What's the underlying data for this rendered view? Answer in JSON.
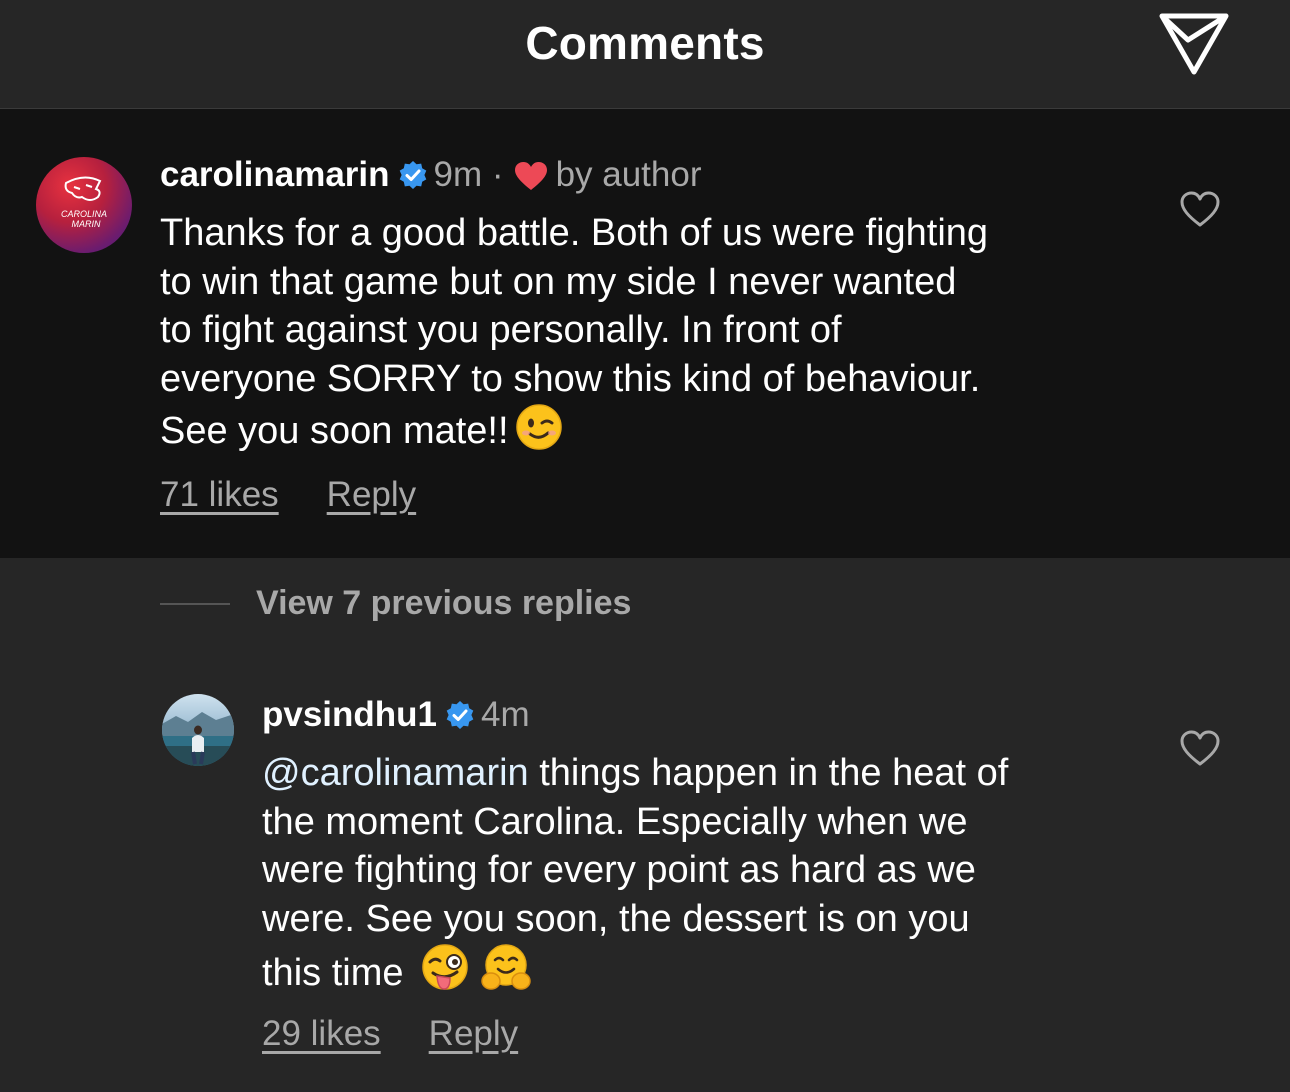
{
  "header": {
    "title": "Comments",
    "send_icon": "paper-plane-icon"
  },
  "comment": {
    "username": "carolinamarin",
    "verified": true,
    "time": "9m",
    "separator": "·",
    "liked_by_author_label": "by author",
    "avatar_text": [
      "CAROLINA",
      "MARIN"
    ],
    "text_lines": [
      "Thanks for a good battle. Both of us were fighting",
      "to win that game but on my side I never wanted",
      "to fight against you personally. In front of",
      "everyone SORRY to show this kind of behaviour.",
      "See you soon mate!!"
    ],
    "emoji": "winking-face",
    "likes_label": "71 likes",
    "reply_label": "Reply",
    "like_icon": "heart-outline-icon"
  },
  "replies_toggle": {
    "label": "View 7 previous replies"
  },
  "reply": {
    "username": "pvsindhu1",
    "verified": true,
    "time": "4m",
    "mention": "@carolinamarin",
    "text_lines": [
      " things happen in the heat of",
      "the moment Carolina. Especially when we",
      "were fighting for every point as hard as we",
      "were. See you soon, the dessert is on you",
      "this time"
    ],
    "emojis": [
      "winking-face-with-tongue",
      "hugging-face"
    ],
    "likes_label": "29 likes",
    "reply_label": "Reply",
    "like_icon": "heart-outline-icon"
  },
  "colors": {
    "background": "#262626",
    "highlight_background": "#121212",
    "secondary_text": "#a8a8a8",
    "verified_blue": "#3897f0",
    "heart_red": "#ed4956"
  }
}
